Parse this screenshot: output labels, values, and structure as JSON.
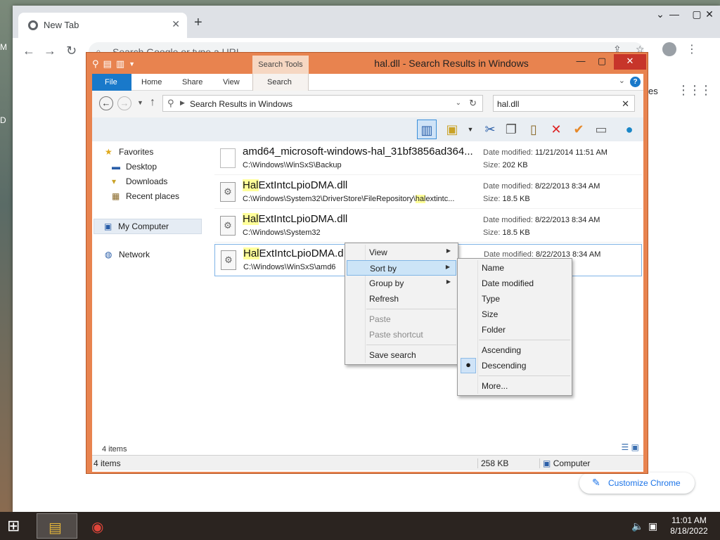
{
  "desktop": {
    "left_glyph_1": "M",
    "left_glyph_2": "D"
  },
  "chrome": {
    "tab_title": "New Tab",
    "tab_close": "✕",
    "new_tab": "+",
    "omnibox_placeholder": "Search Google or type a URL",
    "ntp_partial_text": "es",
    "customize_label": "Customize Chrome"
  },
  "explorer": {
    "title": "hal.dll - Search Results in Windows",
    "context_tab": "Search Tools",
    "ribbon_tabs": [
      "File",
      "Home",
      "Share",
      "View",
      "Search"
    ],
    "address_path": "Search Results in Windows",
    "search_query": "hal.dll",
    "nav_pane": {
      "favorites": "Favorites",
      "desktop": "Desktop",
      "downloads": "Downloads",
      "recent": "Recent places",
      "computer": "My Computer",
      "network": "Network"
    },
    "files": [
      {
        "name": "amd64_microsoft-windows-hal_31bf3856ad364...",
        "name_hl": "",
        "name_rest": "amd64_microsoft-windows-hal_31bf3856ad364...",
        "path": "C:\\Windows\\WinSxS\\Backup",
        "date_label": "Date modified:",
        "date": "11/21/2014 11:51 AM",
        "size_label": "Size:",
        "size": "202 KB"
      },
      {
        "name_hl": "Hal",
        "name_rest": "ExtIntcLpioDMA.dll",
        "path_pre": "C:\\Windows\\System32\\DriverStore\\FileRepository\\",
        "path_hl": "hal",
        "path_post": "extintc...",
        "date_label": "Date modified:",
        "date": "8/22/2013 8:34 AM",
        "size_label": "Size:",
        "size": "18.5 KB"
      },
      {
        "name_hl": "Hal",
        "name_rest": "ExtIntcLpioDMA.dll",
        "path": "C:\\Windows\\System32",
        "date_label": "Date modified:",
        "date": "8/22/2013 8:34 AM",
        "size_label": "Size:",
        "size": "18.5 KB"
      },
      {
        "name_hl": "Hal",
        "name_rest": "ExtIntcLpioDMA.d",
        "path": "C:\\Windows\\WinSxS\\amd6",
        "date_label": "Date modified:",
        "date": "8/22/2013 8:34 AM"
      }
    ],
    "item_count": "4 items",
    "status": {
      "items": "4 items",
      "size": "258 KB",
      "location": "Computer"
    }
  },
  "context_menu": {
    "items": [
      {
        "label": "View",
        "submenu": true
      },
      {
        "label": "Sort by",
        "submenu": true
      },
      {
        "label": "Group by",
        "submenu": true
      },
      {
        "label": "Refresh"
      },
      {
        "label": "Paste",
        "disabled": true
      },
      {
        "label": "Paste shortcut",
        "disabled": true
      },
      {
        "label": "Save search"
      }
    ]
  },
  "sort_menu": {
    "items": [
      "Name",
      "Date modified",
      "Type",
      "Size",
      "Folder",
      "Ascending",
      "Descending",
      "More..."
    ],
    "checked": "Descending"
  },
  "taskbar": {
    "time": "11:01 AM",
    "date": "8/18/2022"
  },
  "colors": {
    "explorer_frame": "#e8834f",
    "highlight": "#ffff99",
    "selection": "#cce4f7",
    "file_tab": "#1979ca"
  }
}
